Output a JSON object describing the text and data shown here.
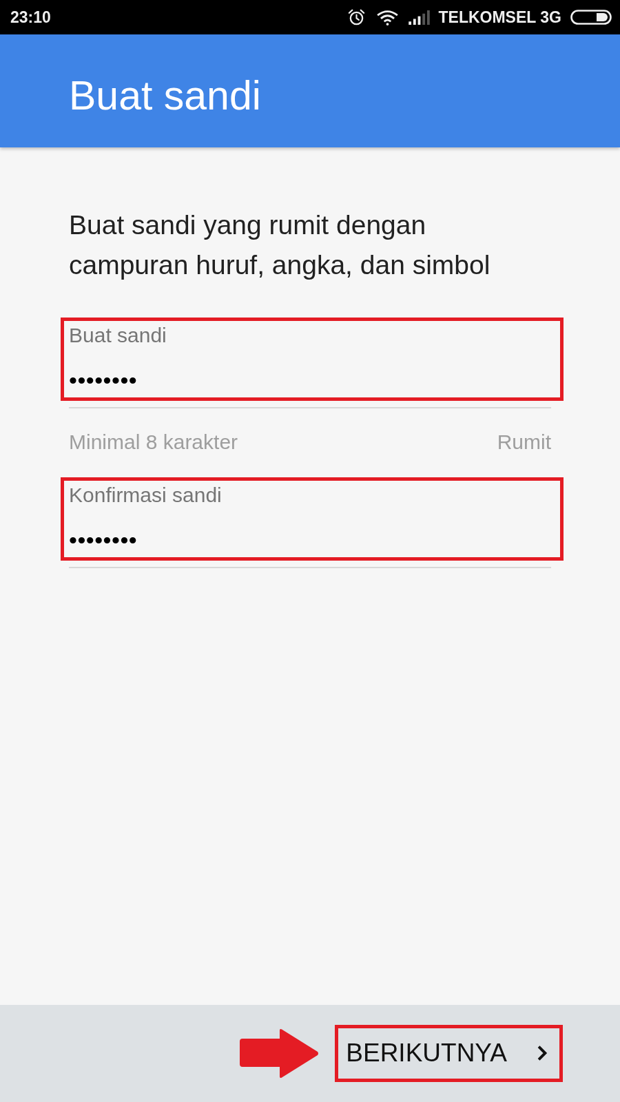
{
  "status_bar": {
    "time": "23:10",
    "carrier": "TELKOMSEL 3G"
  },
  "app_bar": {
    "title": "Buat sandi"
  },
  "description": "Buat sandi yang rumit dengan campuran huruf, angka, dan simbol",
  "fields": [
    {
      "label": "Buat sandi",
      "value": "••••••••",
      "highlighted": true,
      "hint": "Minimal 8 karakter",
      "strength": "Rumit"
    },
    {
      "label": "Konfirmasi sandi",
      "value": "••••••••",
      "highlighted": true
    }
  ],
  "footer": {
    "next_button": {
      "label": "BERIKUTNYA",
      "highlighted": true,
      "pointed_at": true
    }
  }
}
